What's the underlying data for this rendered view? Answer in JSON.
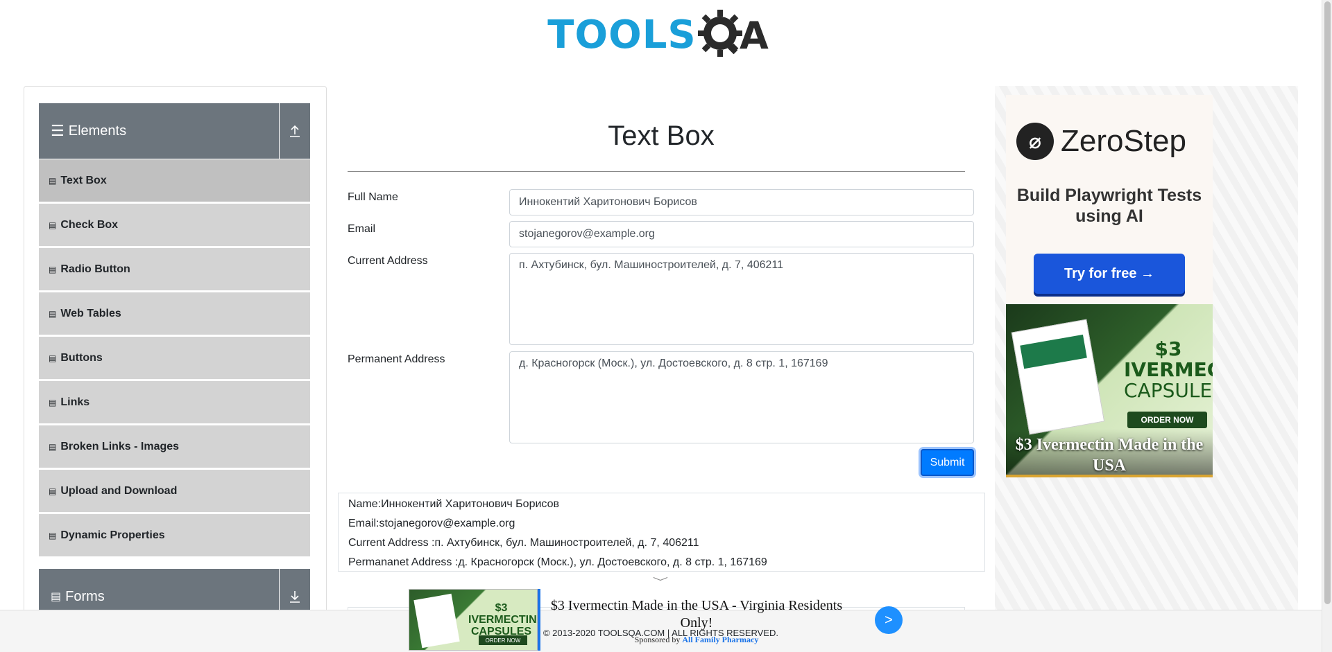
{
  "header": {
    "logo_tools": "TOOLS",
    "logo_qa": "QA"
  },
  "sidebar": {
    "elements_group": {
      "title": "Elements",
      "icon": "hamburger-icon",
      "toggle_icon": "collapse-up-icon"
    },
    "items": [
      {
        "label": "Text Box",
        "active": true
      },
      {
        "label": "Check Box"
      },
      {
        "label": "Radio Button"
      },
      {
        "label": "Web Tables"
      },
      {
        "label": "Buttons"
      },
      {
        "label": "Links"
      },
      {
        "label": "Broken Links - Images"
      },
      {
        "label": "Upload and Download"
      },
      {
        "label": "Dynamic Properties"
      }
    ],
    "forms_group": {
      "title": "Forms",
      "icon": "document-icon",
      "toggle_icon": "expand-down-icon"
    }
  },
  "main": {
    "title": "Text Box",
    "form": {
      "full_name_label": "Full Name",
      "full_name_value": "Иннокентий Харитонович Борисов",
      "email_label": "Email",
      "email_value": "stojanegorov@example.org",
      "current_address_label": "Current Address",
      "current_address_value": "п. Ахтубинск, бул. Машиностроителей, д. 7, 406211",
      "permanent_address_label": "Permanent Address",
      "permanent_address_value": "д. Красногорск (Моск.), ул. Достоевского, д. 8 стр. 1, 167169",
      "submit_label": "Submit"
    },
    "output": {
      "name": "Name:Иннокентий Харитонович Борисов",
      "email": "Email:stojanegorov@example.org",
      "current_address": "Current Address :п. Ахтубинск, бул. Машиностроителей, д. 7, 406211",
      "permanent_address": "Permananet Address :д. Красногорск (Моск.), ул. Достоевского, д. 8 стр. 1, 167169"
    }
  },
  "ads": {
    "zerostep": {
      "brand": "ZeroStep",
      "tagline": "Build Playwright Tests using AI",
      "cta": "Try for free →"
    },
    "ivermectin": {
      "price_line1": "$3",
      "price_line2": "IVERMECTIN",
      "price_line3": "CAPSULES",
      "order": "ORDER NOW",
      "caption": "$3 Ivermectin Made in the USA"
    },
    "bottom_banner": {
      "thumb_price": "$3 IVERMECTIN CAPSULES",
      "thumb_order": "ORDER NOW",
      "title": "$3 Ivermectin Made in the USA - Virginia Residents Only!",
      "sponsored_by": "Sponsored by",
      "sponsor": "All Family Pharmacy",
      "go": ">"
    }
  },
  "footer": {
    "copyright": "© 2013-2020 TOOLSQA.COM | ALL RIGHTS RESERVED."
  },
  "colors": {
    "brand_blue": "#1a9fd9",
    "sidebar_header": "#6c757d",
    "sidebar_item": "#d3d3d3",
    "submit_blue": "#007bff"
  }
}
